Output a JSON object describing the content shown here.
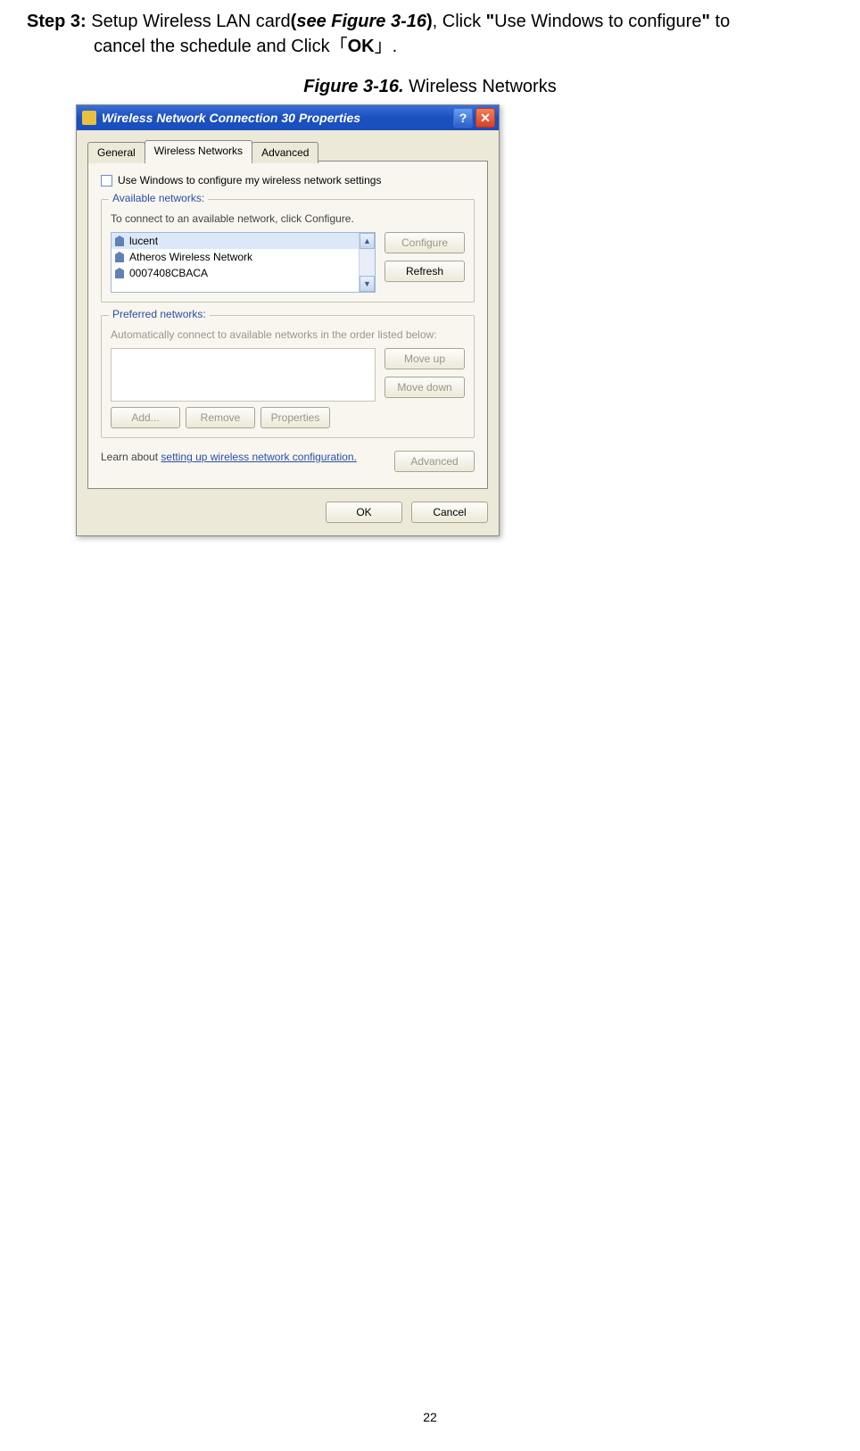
{
  "doc": {
    "step_label": "Step 3:",
    "step_text_1a": " Setup Wireless LAN card",
    "see_open": "(",
    "see_label": "see",
    "see_space": " ",
    "figure_ref": "Figure 3-16",
    "see_close": ")",
    "step_text_1b": ", Click ",
    "quote_open": "\"",
    "click_text": "Use Windows to configure",
    "quote_close": "\"",
    "step_text_1c": " to",
    "step_line2a": "cancel the schedule and Click「",
    "ok_label": "OK",
    "step_line2b": "」.",
    "figure_caption_label": "Figure",
    "figure_caption_num": " 3-16.",
    "figure_caption_text": "    Wireless Networks",
    "page_number": "22"
  },
  "dialog": {
    "title": "Wireless Network Connection 30 Properties",
    "tabs": {
      "general": "General",
      "wireless": "Wireless Networks",
      "advanced": "Advanced"
    },
    "checkbox_label": "Use Windows to configure my wireless network settings",
    "available": {
      "title": "Available networks:",
      "instruction": "To connect to an available network, click Configure.",
      "items": [
        "lucent",
        "Atheros Wireless Network",
        "0007408CBACA"
      ],
      "configure_btn": "Configure",
      "refresh_btn": "Refresh"
    },
    "preferred": {
      "title": "Preferred networks:",
      "instruction": "Automatically connect to available networks in the order listed below:",
      "moveup_btn": "Move up",
      "movedown_btn": "Move down",
      "add_btn": "Add...",
      "remove_btn": "Remove",
      "properties_btn": "Properties"
    },
    "learn_prefix": "Learn about ",
    "learn_link": "setting up wireless network configuration.",
    "advanced_btn": "Advanced",
    "ok_btn": "OK",
    "cancel_btn": "Cancel"
  }
}
